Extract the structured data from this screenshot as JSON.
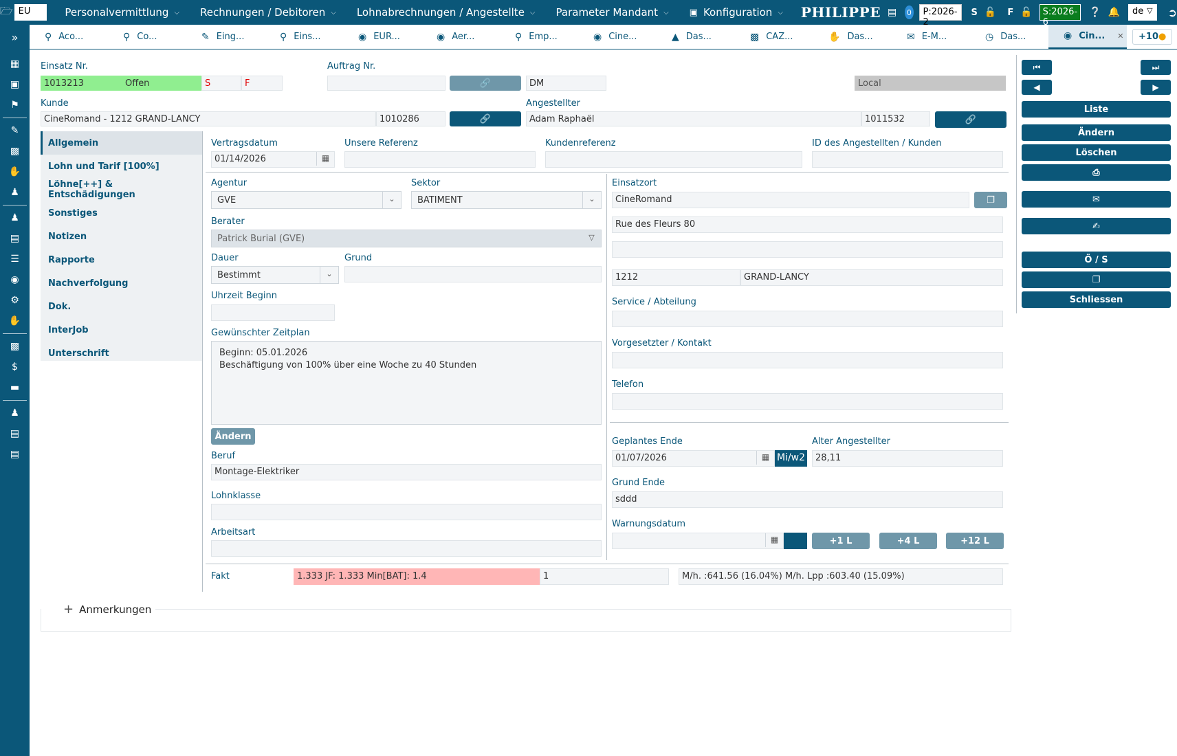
{
  "topbar": {
    "mandant": "EU",
    "menus": [
      "Personalvermittlung",
      "Rechnungen / Debitoren",
      "Lohnabrechnungen / Angestellte",
      "Parameter Mandant",
      "Konfiguration"
    ],
    "brand": "PHILIPPE",
    "notif_count": "0",
    "period_p": "P:2026-2",
    "label_s": "S",
    "label_f": "F",
    "period_s": "S:2026-6",
    "language": "de"
  },
  "tabs": [
    {
      "label": "Aco...",
      "icon": "search-icon"
    },
    {
      "label": "Co...",
      "icon": "search-icon"
    },
    {
      "label": "Eing...",
      "icon": "pencil-icon"
    },
    {
      "label": "Eins...",
      "icon": "search-icon"
    },
    {
      "label": "EUR...",
      "icon": "binoculars-icon"
    },
    {
      "label": "Aer...",
      "icon": "binoculars-icon"
    },
    {
      "label": "Emp...",
      "icon": "search-icon"
    },
    {
      "label": "Cine...",
      "icon": "binoculars-icon"
    },
    {
      "label": "Das...",
      "icon": "chart-icon"
    },
    {
      "label": "CAZ...",
      "icon": "id-card-icon"
    },
    {
      "label": "Das...",
      "icon": "hand-money-icon"
    },
    {
      "label": "E-M...",
      "icon": "envelope-icon"
    },
    {
      "label": "Das...",
      "icon": "clock-icon"
    },
    {
      "label": "Cin...",
      "icon": "binoculars-icon",
      "active": true
    }
  ],
  "tabs_more": "+10",
  "header": {
    "einsatz_label": "Einsatz Nr.",
    "einsatz_nr": "1013213",
    "status": "Offen",
    "flag_s": "S",
    "flag_f": "F",
    "auftrag_label": "Auftrag Nr.",
    "auftrag_nr": "",
    "dm": "DM",
    "local": "Local",
    "kunde_label": "Kunde",
    "kunde": "CineRomand - 1212 GRAND-LANCY",
    "kunde_nr": "1010286",
    "angestellter_label": "Angestellter",
    "angestellter": "Adam Raphaël",
    "angestellter_nr": "1011532"
  },
  "nav": [
    "Allgemein",
    "Lohn und Tarif [100%]",
    "Löhne[++] & Entschädigungen",
    "Sonstiges",
    "Notizen",
    "Rapporte",
    "Nachverfolgung",
    "Dok.",
    "InterJob",
    "Unterschrift"
  ],
  "form": {
    "vertragsdatum_label": "Vertragsdatum",
    "vertragsdatum": "01/14/2026",
    "unsere_referenz_label": "Unsere Referenz",
    "kundenreferenz_label": "Kundenreferenz",
    "id_label": "ID des Angestellten / Kunden",
    "agentur_label": "Agentur",
    "agentur": "GVE",
    "sektor_label": "Sektor",
    "sektor": "BATIMENT",
    "berater_label": "Berater",
    "berater": "Patrick Burial (GVE)",
    "dauer_label": "Dauer",
    "dauer": "Bestimmt",
    "grund_label": "Grund",
    "uhrzeit_label": "Uhrzeit Beginn",
    "zeitplan_label": "Gewünschter Zeitplan",
    "zeitplan_line1": "Beginn: 05.01.2026",
    "zeitplan_line2": "Beschäftigung von 100% über eine Woche zu 40 Stunden",
    "aendern_label": "Ändern",
    "beruf_label": "Beruf",
    "beruf": "Montage-Elektriker",
    "lohnklasse_label": "Lohnklasse",
    "arbeitsart_label": "Arbeitsart",
    "einsatzort_label": "Einsatzort",
    "einsatzort": "CineRomand",
    "strasse": "Rue des Fleurs 80",
    "plz": "1212",
    "ort": "GRAND-LANCY",
    "service_label": "Service / Abteilung",
    "vorgesetzter_label": "Vorgesetzter / Kontakt",
    "telefon_label": "Telefon",
    "geplantes_ende_label": "Geplantes Ende",
    "geplantes_ende": "01/07/2026",
    "miw2": "Mi/w2",
    "alter_label": "Alter Angestellter",
    "alter": "28,11",
    "grund_ende_label": "Grund Ende",
    "grund_ende": "sddd",
    "warnungsdatum_label": "Warnungsdatum",
    "plus1": "+1 L",
    "plus4": "+4 L",
    "plus12": "+12 L",
    "fakt_label": "Fakt",
    "fakt_value": "1.333 JF: 1.333 Min[BAT]: 1.4",
    "fakt_qty": "1",
    "fakt_margin": "M/h. :641.56 (16.04%) M/h. Lpp :603.40 (15.09%)",
    "anmerkungen_label": "Anmerkungen"
  },
  "actions": {
    "liste": "Liste",
    "aendern": "Ändern",
    "loeschen": "Löschen",
    "os": "Ö / S",
    "schliessen": "Schliessen"
  },
  "colors": {
    "primary": "#0b5779",
    "status_green": "#90ee90",
    "fakt_pink": "#ffb6b6",
    "period_green": "#0a7d1e"
  }
}
